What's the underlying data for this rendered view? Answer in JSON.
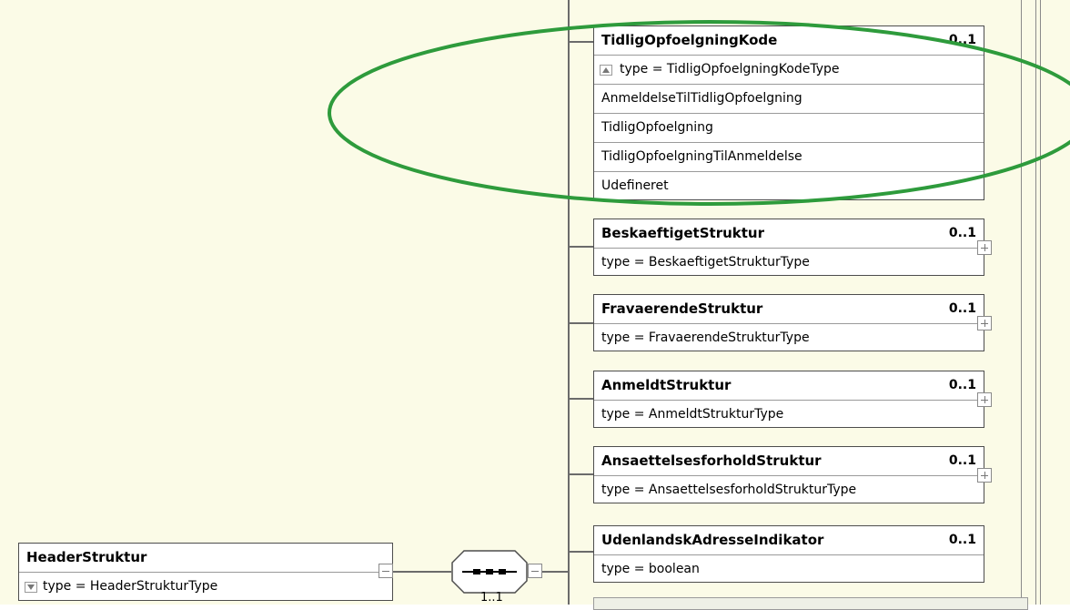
{
  "diagram": {
    "header_element": {
      "name": "HeaderStruktur",
      "type_line": "type = HeaderStrukturType"
    },
    "sequence": {
      "label": "1..1",
      "icon": "sequence-compositor-icon"
    },
    "highlighted_element": {
      "name": "TidligOpfoelgningKode",
      "multiplicity": "0..1",
      "type_line": "type = TidligOpfoelgningKodeType",
      "enumerations": [
        "AnmeldelseTilTidligOpfoelgning",
        "TidligOpfoelgning",
        "TidligOpfoelgningTilAnmeldelse",
        "Udefineret"
      ]
    },
    "elements": [
      {
        "name": "BeskaeftigetStruktur",
        "multiplicity": "0..1",
        "type_line": "type = BeskaeftigetStrukturType"
      },
      {
        "name": "FravaerendeStruktur",
        "multiplicity": "0..1",
        "type_line": "type = FravaerendeStrukturType"
      },
      {
        "name": "AnmeldtStruktur",
        "multiplicity": "0..1",
        "type_line": "type = AnmeldtStrukturType"
      },
      {
        "name": "AnsaettelsesforholdStruktur",
        "multiplicity": "0..1",
        "type_line": "type = AnsaettelsesforholdStrukturType"
      },
      {
        "name": "UdenlandskAdresseIndikator",
        "multiplicity": "0..1",
        "type_line": "type = boolean"
      }
    ],
    "colors": {
      "background": "#fbfbe7",
      "annotation_ellipse": "#2e9b3c",
      "box_border": "#4d4d4d",
      "connector": "#6b6b6b"
    }
  }
}
